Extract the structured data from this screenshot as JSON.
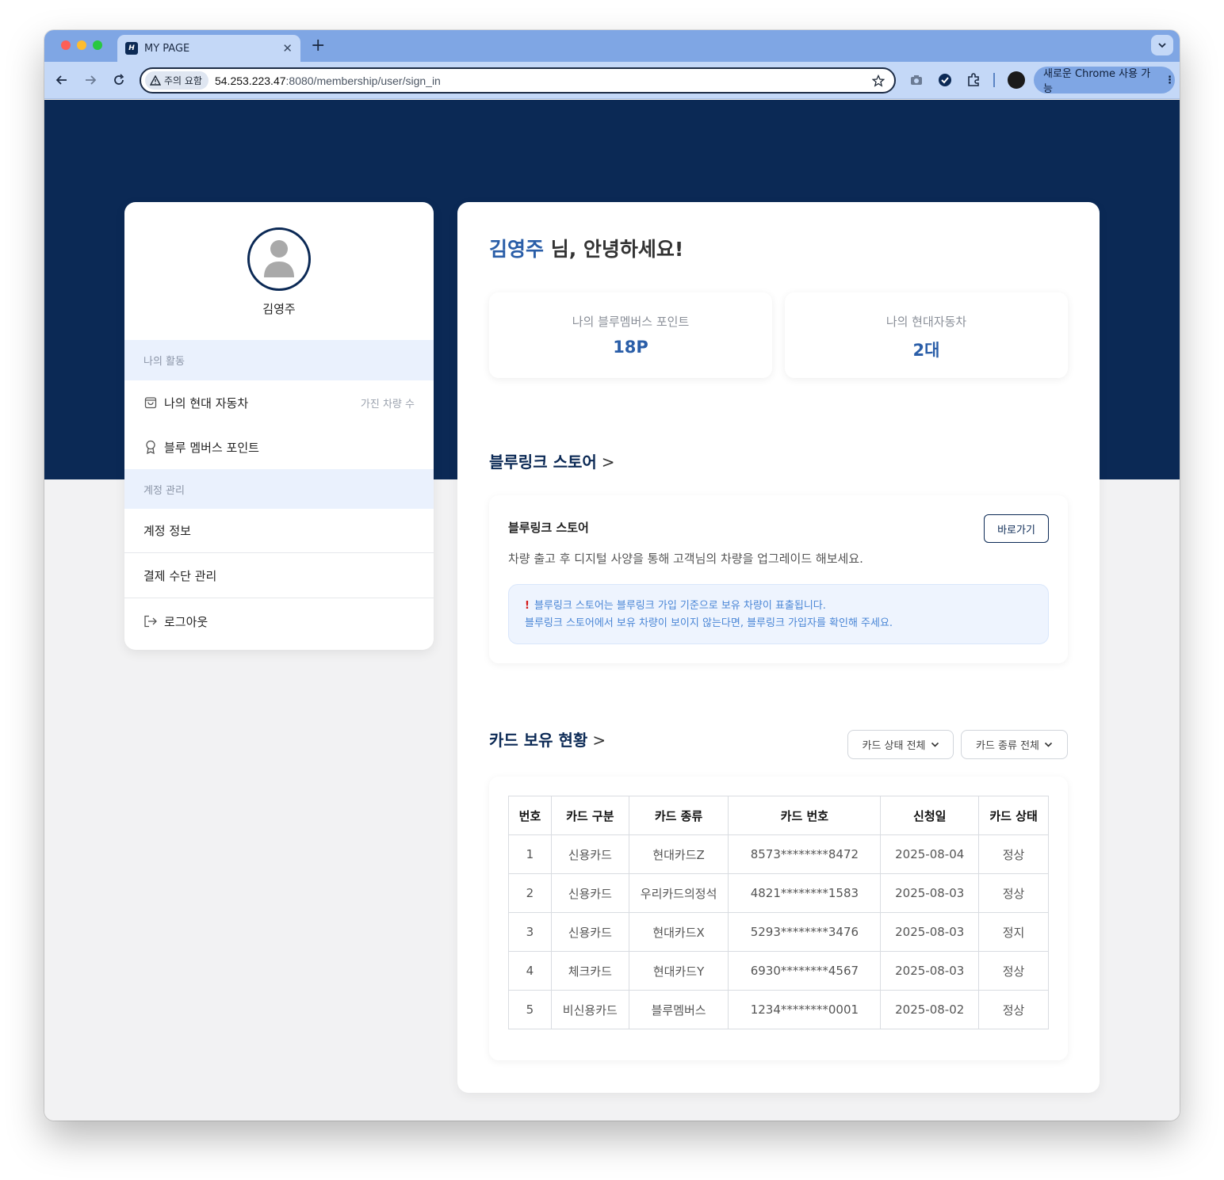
{
  "browser": {
    "tab_title": "MY PAGE",
    "tab_favicon": "H",
    "security_label": "주의 요함",
    "url_host": "54.253.223.47",
    "url_path": ":8080/membership/user/sign_in",
    "chrome_pill": "새로운 Chrome 사용 가능"
  },
  "profile": {
    "name": "김영주"
  },
  "sidebar": {
    "section_activity": "나의 활동",
    "items_activity": [
      {
        "label": "나의 현대 자동차",
        "right": "가진 차량 수"
      },
      {
        "label": "블루 멤버스 포인트"
      }
    ],
    "section_account": "계정 관리",
    "items_account": [
      {
        "label": "계정 정보"
      },
      {
        "label": "결제 수단 관리"
      },
      {
        "label": "로그아웃"
      }
    ]
  },
  "main": {
    "greeting_name": "김영주",
    "greeting_suffix": " 님, 안녕하세요!",
    "stats": [
      {
        "label": "나의 블루멤버스 포인트",
        "value": "18P"
      },
      {
        "label": "나의 현대자동차",
        "value": "2대"
      }
    ],
    "store_section_title": "블루링크 스토어",
    "store_section_chev": ">",
    "store": {
      "title": "블루링크 스토어",
      "button": "바로가기",
      "description": "차량 출고 후 디지털 사양을 통해 고객님의 차량을 업그레이드 해보세요.",
      "notice_mark": "!",
      "notice_line1": "블루링크 스토어는 블루링크 가입 기준으로 보유 차량이 표출됩니다.",
      "notice_line2": "블루링크 스토어에서 보유 차량이 보이지 않는다면, 블루링크 가입자를 확인해 주세요."
    },
    "cards_section_title": "카드 보유 현황",
    "cards_section_chev": ">",
    "filters": {
      "status": "카드 상태 전체",
      "type": "카드 종류 전체"
    },
    "table": {
      "headers": [
        "번호",
        "카드 구분",
        "카드 종류",
        "카드 번호",
        "신청일",
        "카드 상태"
      ],
      "rows": [
        [
          "1",
          "신용카드",
          "현대카드Z",
          "8573********8472",
          "2025-08-04",
          "정상"
        ],
        [
          "2",
          "신용카드",
          "우리카드의정석",
          "4821********1583",
          "2025-08-03",
          "정상"
        ],
        [
          "3",
          "신용카드",
          "현대카드X",
          "5293********3476",
          "2025-08-03",
          "정지"
        ],
        [
          "4",
          "체크카드",
          "현대카드Y",
          "6930********4567",
          "2025-08-03",
          "정상"
        ],
        [
          "5",
          "비신용카드",
          "블루멤버스",
          "1234********0001",
          "2025-08-02",
          "정상"
        ]
      ]
    }
  },
  "colors": {
    "hero": "#0b2955",
    "accent": "#2a5ea8",
    "section_bg": "#eaf1fd"
  }
}
